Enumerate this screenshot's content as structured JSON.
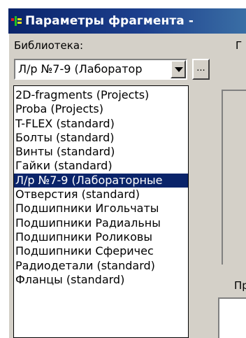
{
  "window": {
    "title": "Параметры фрагмента -",
    "icon": "app-icon"
  },
  "library": {
    "label": "Библиотека:",
    "selected_value": "Л/р №7-9 (Лаборатор",
    "browse_label": "...",
    "dropdown_arrow_icon": "chevron-down-icon"
  },
  "side_labels": {
    "top_right": "Г",
    "bottom_right": "Пр"
  },
  "dropdown_items": [
    {
      "label": "2D-fragments (Projects)",
      "selected": false
    },
    {
      "label": "Proba (Projects)",
      "selected": false
    },
    {
      "label": "T-FLEX (standard)",
      "selected": false
    },
    {
      "label": "Болты (standard)",
      "selected": false
    },
    {
      "label": "Винты (standard)",
      "selected": false
    },
    {
      "label": "Гайки (standard)",
      "selected": false
    },
    {
      "label": "Л/р №7-9 (Лабораторные",
      "selected": true
    },
    {
      "label": "Отверстия (standard)",
      "selected": false
    },
    {
      "label": "Подшипники Игольчаты",
      "selected": false
    },
    {
      "label": "Подшипники Радиальны",
      "selected": false
    },
    {
      "label": "Подшипники Роликовы",
      "selected": false
    },
    {
      "label": "Подшипники Сферичес",
      "selected": false
    },
    {
      "label": "Радиодетали (standard)",
      "selected": false
    },
    {
      "label": "Фланцы (standard)",
      "selected": false
    }
  ],
  "colors": {
    "title_bar": "#0a246a",
    "selection": "#0a246a",
    "dialog_face": "#d4d0c8"
  }
}
